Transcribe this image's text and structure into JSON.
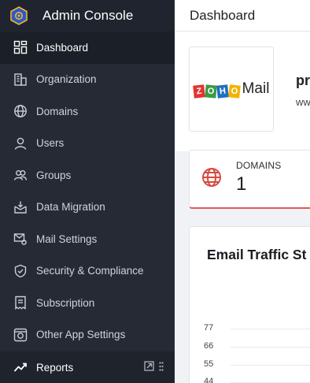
{
  "app": {
    "title": "Admin Console",
    "page_title": "Dashboard"
  },
  "sidebar": {
    "items": [
      {
        "label": "Dashboard",
        "icon": "dashboard-icon",
        "active": true
      },
      {
        "label": "Organization",
        "icon": "building-icon"
      },
      {
        "label": "Domains",
        "icon": "globe-icon"
      },
      {
        "label": "Users",
        "icon": "user-icon"
      },
      {
        "label": "Groups",
        "icon": "groups-icon"
      },
      {
        "label": "Data Migration",
        "icon": "migration-icon"
      },
      {
        "label": "Mail Settings",
        "icon": "mail-settings-icon"
      },
      {
        "label": "Security & Compliance",
        "icon": "shield-icon"
      },
      {
        "label": "Subscription",
        "icon": "subscription-icon"
      },
      {
        "label": "Other App Settings",
        "icon": "app-settings-icon"
      }
    ],
    "reports": {
      "label": "Reports",
      "icon": "trend-icon",
      "actions": [
        "external-link-icon",
        "drag-handle-icon"
      ]
    }
  },
  "org": {
    "logo_text": "ZOHO",
    "logo_suffix": "Mail",
    "name_partial": "pr",
    "url_partial": "ww"
  },
  "domains_card": {
    "label": "DOMAINS",
    "count": "1"
  },
  "traffic_card": {
    "title": "Email Traffic St",
    "y_ticks": [
      "77",
      "66",
      "55",
      "44"
    ]
  },
  "colors": {
    "sidebar_bg": "#252a35",
    "accent_red": "#e25a57",
    "zoho_letters": [
      "#e3342f",
      "#3a9a47",
      "#1f6fc2",
      "#f2b400"
    ]
  }
}
